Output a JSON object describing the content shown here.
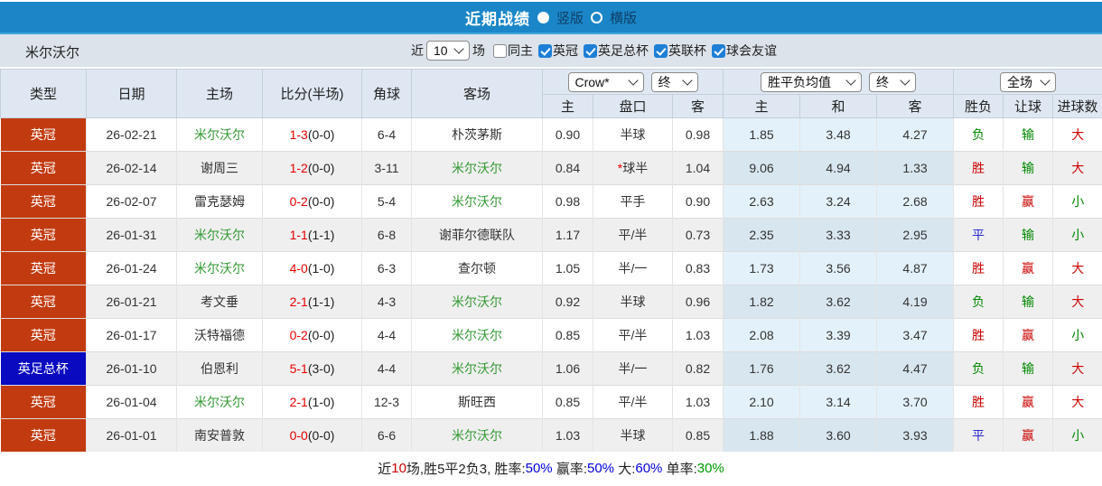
{
  "titlebar": {
    "title": "近期战绩",
    "radio_vertical": "竖版",
    "radio_horizontal": "横版",
    "vertical_selected": true
  },
  "filterbar": {
    "team": "米尔沃尔",
    "near_label": "近",
    "matches_count": "10",
    "matches_label": "场",
    "checkboxes": [
      {
        "label": "同主",
        "checked": false
      },
      {
        "label": "英冠",
        "checked": true
      },
      {
        "label": "英足总杯",
        "checked": true
      },
      {
        "label": "英联杯",
        "checked": true
      },
      {
        "label": "球会友谊",
        "checked": true
      }
    ]
  },
  "table": {
    "headers_left": [
      "类型",
      "日期",
      "主场",
      "比分(半场)",
      "角球",
      "客场"
    ],
    "dropdowns": {
      "company": "Crow*",
      "company_final": "终",
      "avg": "胜平负均值",
      "avg_final": "终",
      "scope": "全场"
    },
    "subheaders": [
      "主",
      "盘口",
      "客",
      "主",
      "和",
      "客",
      "胜负",
      "让球",
      "进球数"
    ],
    "rows": [
      {
        "type": "英冠",
        "type_color": "red",
        "date": "26-02-21",
        "home": "米尔沃尔",
        "home_is_focus": true,
        "score": "1-3",
        "half": "(0-0)",
        "corners": "6-4",
        "away": "朴茨茅斯",
        "away_is_focus": false,
        "ah_home": "0.90",
        "ah_star": false,
        "ah_line": "半球",
        "ah_away": "0.98",
        "avg_home": "1.85",
        "avg_draw": "3.48",
        "avg_away": "4.27",
        "result": "负",
        "result_color": "green",
        "handicap": "输",
        "handicap_color": "green",
        "goals": "大",
        "goals_color": "red"
      },
      {
        "type": "英冠",
        "type_color": "red",
        "date": "26-02-14",
        "home": "谢周三",
        "home_is_focus": false,
        "score": "1-2",
        "half": "(0-0)",
        "corners": "3-11",
        "away": "米尔沃尔",
        "away_is_focus": true,
        "ah_home": "0.84",
        "ah_star": true,
        "ah_line": "球半",
        "ah_away": "1.04",
        "avg_home": "9.06",
        "avg_draw": "4.94",
        "avg_away": "1.33",
        "result": "胜",
        "result_color": "red",
        "handicap": "输",
        "handicap_color": "green",
        "goals": "大",
        "goals_color": "red"
      },
      {
        "type": "英冠",
        "type_color": "red",
        "date": "26-02-07",
        "home": "雷克瑟姆",
        "home_is_focus": false,
        "score": "0-2",
        "half": "(0-0)",
        "corners": "5-4",
        "away": "米尔沃尔",
        "away_is_focus": true,
        "ah_home": "0.98",
        "ah_star": false,
        "ah_line": "平手",
        "ah_away": "0.90",
        "avg_home": "2.63",
        "avg_draw": "3.24",
        "avg_away": "2.68",
        "result": "胜",
        "result_color": "red",
        "handicap": "赢",
        "handicap_color": "red",
        "goals": "小",
        "goals_color": "green"
      },
      {
        "type": "英冠",
        "type_color": "red",
        "date": "26-01-31",
        "home": "米尔沃尔",
        "home_is_focus": true,
        "score": "1-1",
        "half": "(1-1)",
        "corners": "6-8",
        "away": "谢菲尔德联队",
        "away_is_focus": false,
        "ah_home": "1.17",
        "ah_star": false,
        "ah_line": "平/半",
        "ah_away": "0.73",
        "avg_home": "2.35",
        "avg_draw": "3.33",
        "avg_away": "2.95",
        "result": "平",
        "result_color": "blue",
        "handicap": "输",
        "handicap_color": "green",
        "goals": "小",
        "goals_color": "green"
      },
      {
        "type": "英冠",
        "type_color": "red",
        "date": "26-01-24",
        "home": "米尔沃尔",
        "home_is_focus": true,
        "score": "4-0",
        "half": "(1-0)",
        "corners": "6-3",
        "away": "查尔顿",
        "away_is_focus": false,
        "ah_home": "1.05",
        "ah_star": false,
        "ah_line": "半/一",
        "ah_away": "0.83",
        "avg_home": "1.73",
        "avg_draw": "3.56",
        "avg_away": "4.87",
        "result": "胜",
        "result_color": "red",
        "handicap": "赢",
        "handicap_color": "red",
        "goals": "大",
        "goals_color": "red"
      },
      {
        "type": "英冠",
        "type_color": "red",
        "date": "26-01-21",
        "home": "考文垂",
        "home_is_focus": false,
        "score": "2-1",
        "half": "(1-1)",
        "corners": "4-3",
        "away": "米尔沃尔",
        "away_is_focus": true,
        "ah_home": "0.92",
        "ah_star": false,
        "ah_line": "半球",
        "ah_away": "0.96",
        "avg_home": "1.82",
        "avg_draw": "3.62",
        "avg_away": "4.19",
        "result": "负",
        "result_color": "green",
        "handicap": "输",
        "handicap_color": "green",
        "goals": "大",
        "goals_color": "red"
      },
      {
        "type": "英冠",
        "type_color": "red",
        "date": "26-01-17",
        "home": "沃特福德",
        "home_is_focus": false,
        "score": "0-2",
        "half": "(0-0)",
        "corners": "4-4",
        "away": "米尔沃尔",
        "away_is_focus": true,
        "ah_home": "0.85",
        "ah_star": false,
        "ah_line": "平/半",
        "ah_away": "1.03",
        "avg_home": "2.08",
        "avg_draw": "3.39",
        "avg_away": "3.47",
        "result": "胜",
        "result_color": "red",
        "handicap": "赢",
        "handicap_color": "red",
        "goals": "小",
        "goals_color": "green"
      },
      {
        "type": "英足总杯",
        "type_color": "blue",
        "date": "26-01-10",
        "home": "伯恩利",
        "home_is_focus": false,
        "score": "5-1",
        "half": "(3-0)",
        "corners": "4-4",
        "away": "米尔沃尔",
        "away_is_focus": true,
        "ah_home": "1.06",
        "ah_star": false,
        "ah_line": "半/一",
        "ah_away": "0.82",
        "avg_home": "1.76",
        "avg_draw": "3.62",
        "avg_away": "4.47",
        "result": "负",
        "result_color": "green",
        "handicap": "输",
        "handicap_color": "green",
        "goals": "大",
        "goals_color": "red"
      },
      {
        "type": "英冠",
        "type_color": "red",
        "date": "26-01-04",
        "home": "米尔沃尔",
        "home_is_focus": true,
        "score": "2-1",
        "half": "(1-0)",
        "corners": "12-3",
        "away": "斯旺西",
        "away_is_focus": false,
        "ah_home": "0.85",
        "ah_star": false,
        "ah_line": "平/半",
        "ah_away": "1.03",
        "avg_home": "2.10",
        "avg_draw": "3.14",
        "avg_away": "3.70",
        "result": "胜",
        "result_color": "red",
        "handicap": "赢",
        "handicap_color": "red",
        "goals": "大",
        "goals_color": "red"
      },
      {
        "type": "英冠",
        "type_color": "red",
        "date": "26-01-01",
        "home": "南安普敦",
        "home_is_focus": false,
        "score": "0-0",
        "half": "(0-0)",
        "corners": "6-6",
        "away": "米尔沃尔",
        "away_is_focus": true,
        "ah_home": "1.03",
        "ah_star": false,
        "ah_line": "半球",
        "ah_away": "0.85",
        "avg_home": "1.88",
        "avg_draw": "3.60",
        "avg_away": "3.93",
        "result": "平",
        "result_color": "blue",
        "handicap": "赢",
        "handicap_color": "red",
        "goals": "小",
        "goals_color": "green"
      }
    ]
  },
  "footer": {
    "segments": [
      {
        "text": "近",
        "color": "black"
      },
      {
        "text": "10",
        "color": "red"
      },
      {
        "text": "场,胜5平2负3, 胜率:",
        "color": "black"
      },
      {
        "text": "50%",
        "color": "blue"
      },
      {
        "text": " 赢率:",
        "color": "black"
      },
      {
        "text": "50%",
        "color": "blue"
      },
      {
        "text": " 大:",
        "color": "black"
      },
      {
        "text": "60%",
        "color": "blue"
      },
      {
        "text": " 单率:",
        "color": "black"
      },
      {
        "text": "30%",
        "color": "green"
      }
    ]
  },
  "colors": {
    "topbar_blue": "#1a86c8",
    "league_red": "#c23b10",
    "cup_blue": "#0a0ac0",
    "result_red": "#cc0000",
    "result_green": "#008800",
    "result_blue": "#2a2ad0",
    "team_green": "#339933",
    "score_red": "#e60000",
    "link_blue": "#0000e0",
    "pct_green": "#009900"
  }
}
